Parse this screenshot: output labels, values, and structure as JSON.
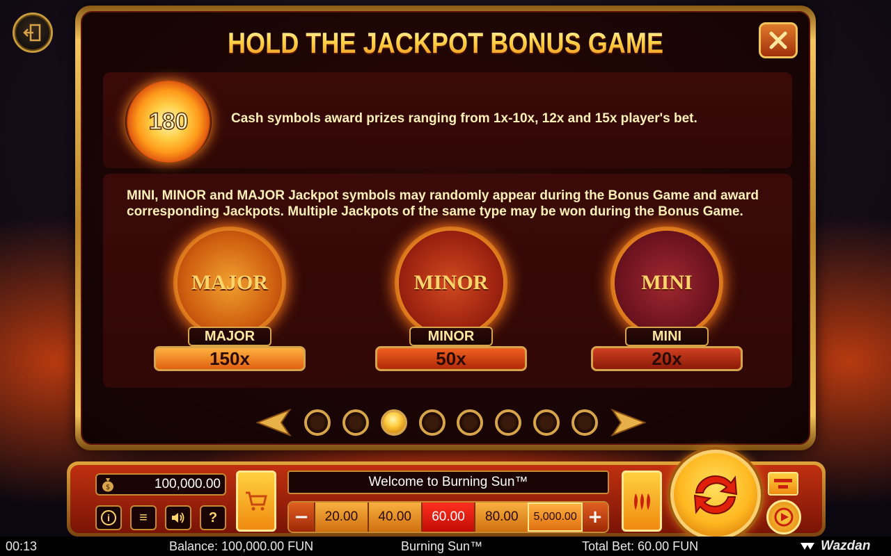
{
  "modal": {
    "title": "HOLD THE JACKPOT BONUS GAME",
    "cash_symbol_value": "180",
    "cash_text": "Cash symbols award prizes ranging from 1x-10x, 12x and 15x player's bet.",
    "jackpot_text": "MINI, MINOR and MAJOR Jackpot symbols may randomly appear during the Bonus Game and award corresponding Jackpots. Multiple Jackpots of the same type may be won during the Bonus Game.",
    "jackpots": [
      {
        "symbol": "MAJOR",
        "label": "MAJOR",
        "value": "150x"
      },
      {
        "symbol": "MINOR",
        "label": "MINOR",
        "value": "50x"
      },
      {
        "symbol": "MINI",
        "label": "MINI",
        "value": "20x"
      }
    ],
    "pages": 8,
    "current_page": 3
  },
  "console": {
    "balance": "100,000.00",
    "message": "Welcome to Burning Sun™",
    "minus": "−",
    "plus": "+",
    "bets": [
      "20.00",
      "40.00",
      "60.00",
      "80.00",
      "5,000.00"
    ],
    "selected_bet": "60.00",
    "info_label": "i",
    "menu_label": "≡",
    "help_label": "?"
  },
  "status": {
    "clock": "00:13",
    "balance": "Balance: 100,000.00 FUN",
    "game_name": "Burning Sun™",
    "total_bet": "Total Bet: 60.00 FUN",
    "brand": "Wazdan"
  },
  "icons": {
    "exit": "exit-icon",
    "close": "close-icon",
    "cart": "cart-icon",
    "chili": "chili-icon",
    "spin": "spin-icon",
    "sound": "sound-icon"
  },
  "colors": {
    "accent_gold": "#f0c35b",
    "panel_dark": "#3a0a08",
    "title_gold": "#ffd34a"
  }
}
